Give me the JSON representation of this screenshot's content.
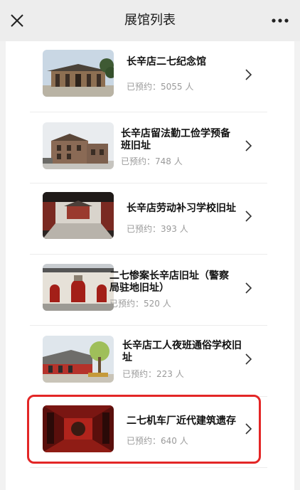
{
  "header": {
    "title": "展馆列表",
    "close_icon": "close-icon",
    "more_icon": "more-icon"
  },
  "venues": [
    {
      "name": "长辛店二七纪念馆",
      "count": "已预约：5055 人",
      "thumb": "memorial-hall-photo"
    },
    {
      "name": "长辛店留法勤工俭学预备班旧址",
      "count": "已预约：748 人",
      "thumb": "brick-building-photo"
    },
    {
      "name": "长辛店劳动补习学校旧址",
      "count": "已预约：393 人",
      "thumb": "courtyard-photo"
    },
    {
      "name": "二七惨案长辛店旧址（警察局驻地旧址）",
      "count": "已预约：520 人",
      "thumb": "red-door-wall-photo"
    },
    {
      "name": "长辛店工人夜班通俗学校旧址",
      "count": "已预约：223 人",
      "thumb": "school-courtyard-photo"
    },
    {
      "name": "二七机车厂近代建筑遗存",
      "count": "已预约：640 人",
      "thumb": "red-interior-photo"
    }
  ],
  "highlight_color": "#e32626"
}
